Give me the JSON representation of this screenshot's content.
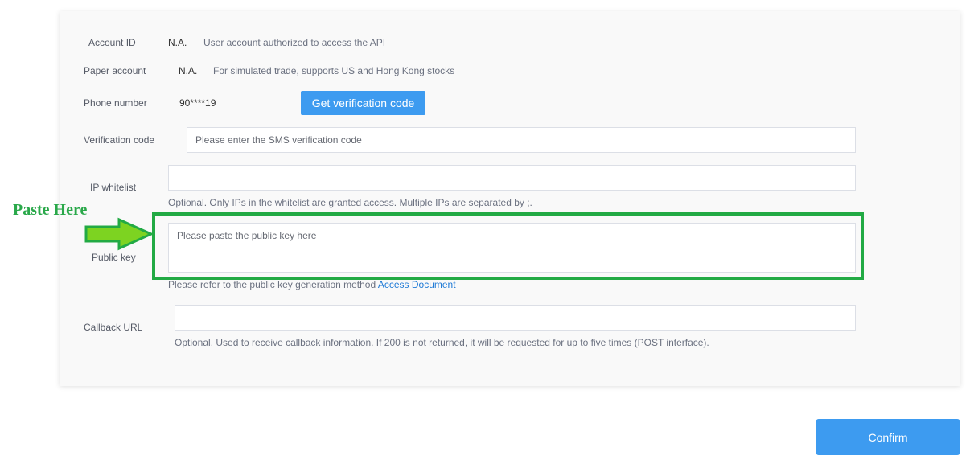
{
  "form": {
    "account_id": {
      "label": "Account ID",
      "value": "N.A.",
      "description": "User account authorized to access the API"
    },
    "paper_account": {
      "label": "Paper account",
      "value": "N.A.",
      "description": "For simulated trade, supports US and Hong Kong stocks"
    },
    "phone": {
      "label": "Phone number",
      "value": "90****19",
      "button_label": "Get verification code"
    },
    "verification": {
      "label": "Verification code",
      "placeholder": "Please enter the SMS verification code",
      "value": ""
    },
    "ip_whitelist": {
      "label": "IP whitelist",
      "value": "",
      "hint": "Optional. Only IPs in the whitelist are granted access. Multiple IPs are separated by ;."
    },
    "public_key": {
      "label": "Public key",
      "placeholder": "Please paste the public key here",
      "value": "",
      "hint": "Please refer to the public key generation method",
      "link_text": "Access Document"
    },
    "callback": {
      "label": "Callback URL",
      "value": "",
      "hint": "Optional. Used to receive callback information. If 200 is not returned, it will be requested for up to five times (POST interface)."
    }
  },
  "confirm_label": "Confirm",
  "annotation": {
    "text": "Paste Here",
    "color": "#22aa44",
    "arrow_color": "#7dd321"
  },
  "colors": {
    "primary": "#3d9bf0",
    "link": "#1f7ad6"
  }
}
